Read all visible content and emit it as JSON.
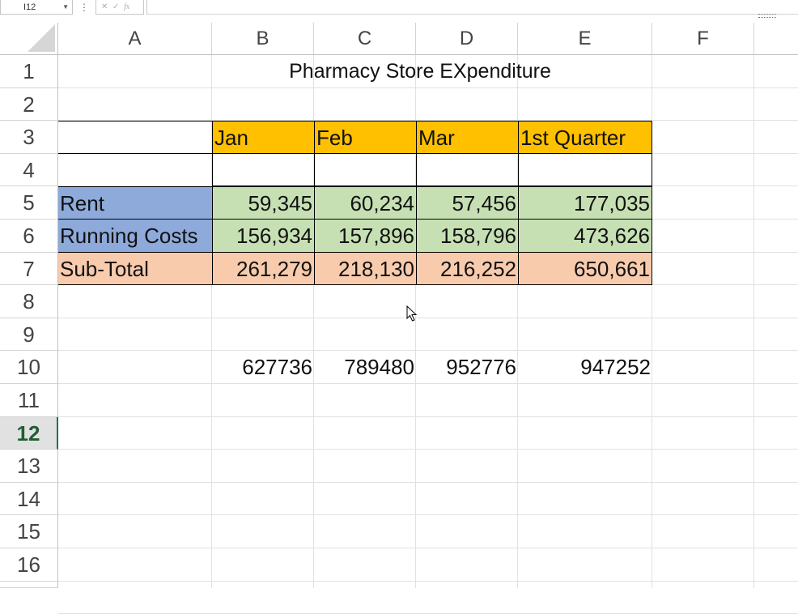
{
  "formula_bar": {
    "name_box": "I12",
    "dots": "⋮",
    "cancel": "✕",
    "enter": "✓",
    "fx": "fx",
    "formula_value": ""
  },
  "columns": [
    "A",
    "B",
    "C",
    "D",
    "E",
    "F"
  ],
  "rows": [
    "1",
    "2",
    "3",
    "4",
    "5",
    "6",
    "7",
    "8",
    "9",
    "10",
    "11",
    "12",
    "13",
    "14",
    "15",
    "16"
  ],
  "selected_row": "12",
  "sheet": {
    "title": "Pharmacy Store EXpenditure",
    "headers": [
      "Jan",
      "Feb",
      "Mar",
      "1st Quarter"
    ],
    "table_rows": [
      {
        "label": "Rent",
        "values": [
          "59,345",
          "60,234",
          "57,456",
          "177,035"
        ]
      },
      {
        "label": "Running Costs",
        "values": [
          "156,934",
          "157,896",
          "158,796",
          "473,626"
        ]
      },
      {
        "label": "Sub-Total",
        "values": [
          "261,279",
          "218,130",
          "216,252",
          "650,661"
        ]
      }
    ],
    "row10_values": [
      "627736",
      "789480",
      "952776",
      "947252"
    ]
  },
  "colors": {
    "header_fill": "#ffc000",
    "label_fill": "#8eaadb",
    "value_fill": "#c6e0b4",
    "subtotal_fill": "#f8cbad",
    "selection_accent": "#217346"
  }
}
